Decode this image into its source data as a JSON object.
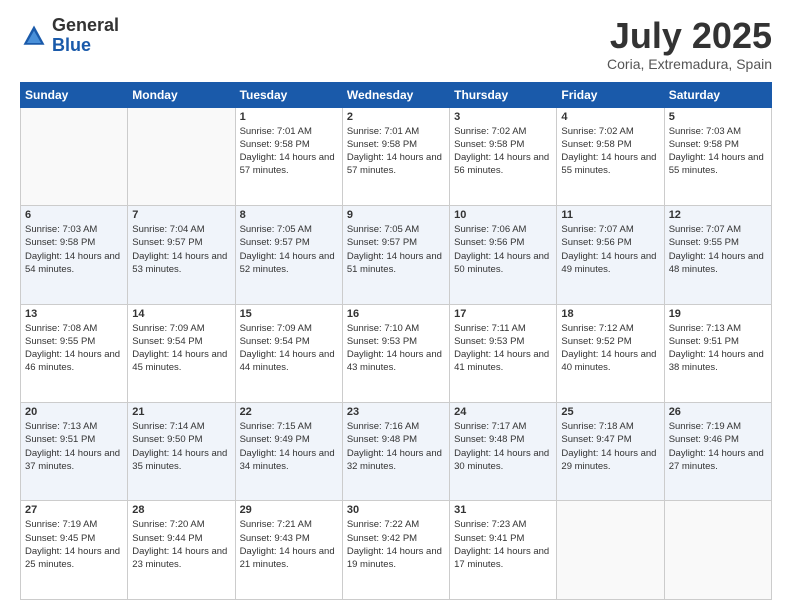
{
  "header": {
    "logo_general": "General",
    "logo_blue": "Blue",
    "month_year": "July 2025",
    "location": "Coria, Extremadura, Spain"
  },
  "weekdays": [
    "Sunday",
    "Monday",
    "Tuesday",
    "Wednesday",
    "Thursday",
    "Friday",
    "Saturday"
  ],
  "weeks": [
    [
      {
        "day": "",
        "sunrise": "",
        "sunset": "",
        "daylight": ""
      },
      {
        "day": "",
        "sunrise": "",
        "sunset": "",
        "daylight": ""
      },
      {
        "day": "1",
        "sunrise": "Sunrise: 7:01 AM",
        "sunset": "Sunset: 9:58 PM",
        "daylight": "Daylight: 14 hours and 57 minutes."
      },
      {
        "day": "2",
        "sunrise": "Sunrise: 7:01 AM",
        "sunset": "Sunset: 9:58 PM",
        "daylight": "Daylight: 14 hours and 57 minutes."
      },
      {
        "day": "3",
        "sunrise": "Sunrise: 7:02 AM",
        "sunset": "Sunset: 9:58 PM",
        "daylight": "Daylight: 14 hours and 56 minutes."
      },
      {
        "day": "4",
        "sunrise": "Sunrise: 7:02 AM",
        "sunset": "Sunset: 9:58 PM",
        "daylight": "Daylight: 14 hours and 55 minutes."
      },
      {
        "day": "5",
        "sunrise": "Sunrise: 7:03 AM",
        "sunset": "Sunset: 9:58 PM",
        "daylight": "Daylight: 14 hours and 55 minutes."
      }
    ],
    [
      {
        "day": "6",
        "sunrise": "Sunrise: 7:03 AM",
        "sunset": "Sunset: 9:58 PM",
        "daylight": "Daylight: 14 hours and 54 minutes."
      },
      {
        "day": "7",
        "sunrise": "Sunrise: 7:04 AM",
        "sunset": "Sunset: 9:57 PM",
        "daylight": "Daylight: 14 hours and 53 minutes."
      },
      {
        "day": "8",
        "sunrise": "Sunrise: 7:05 AM",
        "sunset": "Sunset: 9:57 PM",
        "daylight": "Daylight: 14 hours and 52 minutes."
      },
      {
        "day": "9",
        "sunrise": "Sunrise: 7:05 AM",
        "sunset": "Sunset: 9:57 PM",
        "daylight": "Daylight: 14 hours and 51 minutes."
      },
      {
        "day": "10",
        "sunrise": "Sunrise: 7:06 AM",
        "sunset": "Sunset: 9:56 PM",
        "daylight": "Daylight: 14 hours and 50 minutes."
      },
      {
        "day": "11",
        "sunrise": "Sunrise: 7:07 AM",
        "sunset": "Sunset: 9:56 PM",
        "daylight": "Daylight: 14 hours and 49 minutes."
      },
      {
        "day": "12",
        "sunrise": "Sunrise: 7:07 AM",
        "sunset": "Sunset: 9:55 PM",
        "daylight": "Daylight: 14 hours and 48 minutes."
      }
    ],
    [
      {
        "day": "13",
        "sunrise": "Sunrise: 7:08 AM",
        "sunset": "Sunset: 9:55 PM",
        "daylight": "Daylight: 14 hours and 46 minutes."
      },
      {
        "day": "14",
        "sunrise": "Sunrise: 7:09 AM",
        "sunset": "Sunset: 9:54 PM",
        "daylight": "Daylight: 14 hours and 45 minutes."
      },
      {
        "day": "15",
        "sunrise": "Sunrise: 7:09 AM",
        "sunset": "Sunset: 9:54 PM",
        "daylight": "Daylight: 14 hours and 44 minutes."
      },
      {
        "day": "16",
        "sunrise": "Sunrise: 7:10 AM",
        "sunset": "Sunset: 9:53 PM",
        "daylight": "Daylight: 14 hours and 43 minutes."
      },
      {
        "day": "17",
        "sunrise": "Sunrise: 7:11 AM",
        "sunset": "Sunset: 9:53 PM",
        "daylight": "Daylight: 14 hours and 41 minutes."
      },
      {
        "day": "18",
        "sunrise": "Sunrise: 7:12 AM",
        "sunset": "Sunset: 9:52 PM",
        "daylight": "Daylight: 14 hours and 40 minutes."
      },
      {
        "day": "19",
        "sunrise": "Sunrise: 7:13 AM",
        "sunset": "Sunset: 9:51 PM",
        "daylight": "Daylight: 14 hours and 38 minutes."
      }
    ],
    [
      {
        "day": "20",
        "sunrise": "Sunrise: 7:13 AM",
        "sunset": "Sunset: 9:51 PM",
        "daylight": "Daylight: 14 hours and 37 minutes."
      },
      {
        "day": "21",
        "sunrise": "Sunrise: 7:14 AM",
        "sunset": "Sunset: 9:50 PM",
        "daylight": "Daylight: 14 hours and 35 minutes."
      },
      {
        "day": "22",
        "sunrise": "Sunrise: 7:15 AM",
        "sunset": "Sunset: 9:49 PM",
        "daylight": "Daylight: 14 hours and 34 minutes."
      },
      {
        "day": "23",
        "sunrise": "Sunrise: 7:16 AM",
        "sunset": "Sunset: 9:48 PM",
        "daylight": "Daylight: 14 hours and 32 minutes."
      },
      {
        "day": "24",
        "sunrise": "Sunrise: 7:17 AM",
        "sunset": "Sunset: 9:48 PM",
        "daylight": "Daylight: 14 hours and 30 minutes."
      },
      {
        "day": "25",
        "sunrise": "Sunrise: 7:18 AM",
        "sunset": "Sunset: 9:47 PM",
        "daylight": "Daylight: 14 hours and 29 minutes."
      },
      {
        "day": "26",
        "sunrise": "Sunrise: 7:19 AM",
        "sunset": "Sunset: 9:46 PM",
        "daylight": "Daylight: 14 hours and 27 minutes."
      }
    ],
    [
      {
        "day": "27",
        "sunrise": "Sunrise: 7:19 AM",
        "sunset": "Sunset: 9:45 PM",
        "daylight": "Daylight: 14 hours and 25 minutes."
      },
      {
        "day": "28",
        "sunrise": "Sunrise: 7:20 AM",
        "sunset": "Sunset: 9:44 PM",
        "daylight": "Daylight: 14 hours and 23 minutes."
      },
      {
        "day": "29",
        "sunrise": "Sunrise: 7:21 AM",
        "sunset": "Sunset: 9:43 PM",
        "daylight": "Daylight: 14 hours and 21 minutes."
      },
      {
        "day": "30",
        "sunrise": "Sunrise: 7:22 AM",
        "sunset": "Sunset: 9:42 PM",
        "daylight": "Daylight: 14 hours and 19 minutes."
      },
      {
        "day": "31",
        "sunrise": "Sunrise: 7:23 AM",
        "sunset": "Sunset: 9:41 PM",
        "daylight": "Daylight: 14 hours and 17 minutes."
      },
      {
        "day": "",
        "sunrise": "",
        "sunset": "",
        "daylight": ""
      },
      {
        "day": "",
        "sunrise": "",
        "sunset": "",
        "daylight": ""
      }
    ]
  ]
}
